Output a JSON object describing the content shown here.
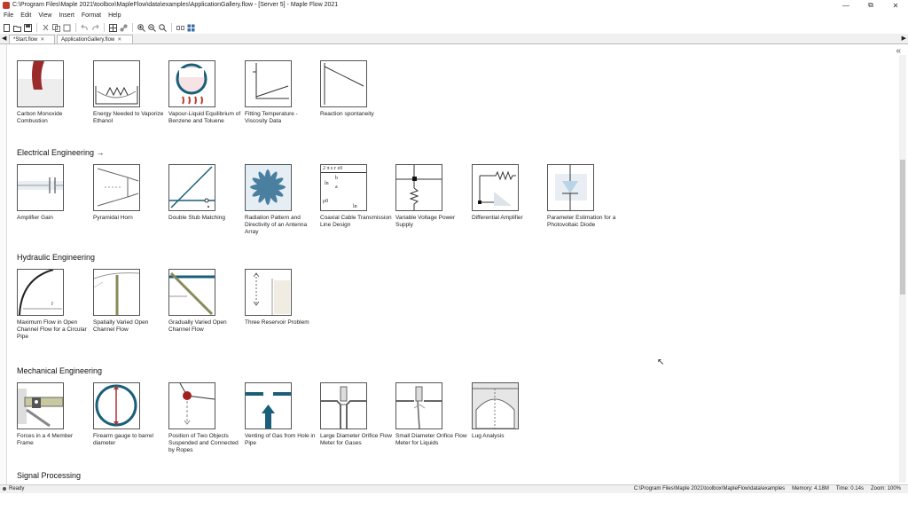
{
  "window": {
    "title": "C:\\Program Files\\Maple 2021\\toolbox\\MapleFlow\\data\\examples\\ApplicationGallery.flow - [Server 5] - Maple Flow 2021"
  },
  "menu": [
    "File",
    "Edit",
    "View",
    "Insert",
    "Format",
    "Help"
  ],
  "tabs": [
    {
      "label": "*Start.flow"
    },
    {
      "label": "ApplicationGallery.flow"
    }
  ],
  "rows": {
    "top": [
      {
        "label": "Carbon Monoxide Combustion"
      },
      {
        "label": "Energy Needed to Vaporize Ethanol"
      },
      {
        "label": "Vapour-Liquid Equilibrium of Benzene and Toluene"
      },
      {
        "label": "Fitting Temperature -Viscosity Data"
      },
      {
        "label": "Reaction spontaneity"
      }
    ],
    "electrical": {
      "title": "Electrical Engineering →",
      "items": [
        {
          "label": "Amplifier Gain"
        },
        {
          "label": "Pyramidal Horn"
        },
        {
          "label": "Double Stub Matching"
        },
        {
          "label": "Radiation Pattern and Directivity of an Antenna Array"
        },
        {
          "label": "Coaxial Cable Transmission Line Design"
        },
        {
          "label": "Variable Voltage Power Supply"
        },
        {
          "label": "Differential Amplifier"
        },
        {
          "label": "Parameter Estimation for a Photovoltaic Diode"
        }
      ]
    },
    "hydraulic": {
      "title": "Hydraulic Engineering",
      "items": [
        {
          "label": "Maximum Flow in Open Channel Flow for a Circular Pipe"
        },
        {
          "label": "Spatially Varied Open Channel Flow"
        },
        {
          "label": "Gradually Varied Open Channel Flow"
        },
        {
          "label": "Three Reservoir Problem"
        }
      ]
    },
    "mechanical": {
      "title": "Mechanical Engineering",
      "items": [
        {
          "label": "Forces in a 4 Member Frame"
        },
        {
          "label": "Firearm gauge to barrel diameter"
        },
        {
          "label": "Position of Two Objects Suspended and Connected by Ropes"
        },
        {
          "label": "Venting of Gas from Hole in Pipe"
        },
        {
          "label": "Large Diameter Orifice Flow Meter for Gases"
        },
        {
          "label": "Small Diameter Orifice Flow Meter for Liquids"
        },
        {
          "label": "Lug Analysis"
        }
      ]
    },
    "next_section": "Signal Processing"
  },
  "coax_formula": {
    "line1": "2 π ε r ε0",
    "ln": "ln",
    "frac_top": "b",
    "frac_bot": "a",
    "mu": "μ0",
    "ln2": "ln"
  },
  "status": {
    "left": "Ready",
    "path": "C:\\Program Files\\Maple 2021\\toolbox\\MapleFlow\\data\\examples",
    "memory": "Memory: 4.18M",
    "time": "Time: 0.14s",
    "zoom": "Zoom: 100%"
  },
  "colors": {
    "accent": "#1a5f7a",
    "red": "#b03030",
    "olive": "#8a8a5a",
    "steel": "#4a7fa0"
  }
}
